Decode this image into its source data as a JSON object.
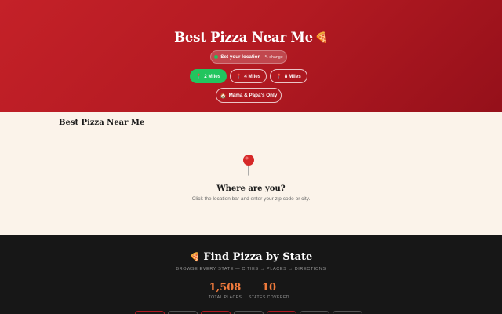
{
  "hero": {
    "title": "Best Pizza Near Me",
    "title_emoji": "🍕",
    "location": {
      "label": "Set your location",
      "change": "✎ change"
    },
    "radius_options": [
      {
        "label": "2 Miles",
        "icon": "📍",
        "active": true
      },
      {
        "label": "4 Miles",
        "icon": "📍",
        "active": false
      },
      {
        "label": "8 Miles",
        "icon": "📍",
        "active": false
      }
    ],
    "filter": {
      "label": "Mama & Papa's Only",
      "icon": "🏠"
    }
  },
  "main": {
    "heading": "Best Pizza Near Me",
    "empty_title": "Where are you?",
    "empty_subtitle": "Click the location bar and enter your zip code or city."
  },
  "states": {
    "title": "Find Pizza by State",
    "title_emoji": "🍕",
    "subtitle": "BROWSE EVERY STATE — CITIES → PLACES → DIRECTIONS",
    "stats": [
      {
        "value": "1,508",
        "label": "TOTAL PLACES"
      },
      {
        "value": "10",
        "label": "STATES COVERED"
      }
    ]
  },
  "colors": {
    "hero_red": "#c42128",
    "accent_green": "#22c55e",
    "stat_orange": "#f07a3c",
    "dark_bg": "#171717",
    "cream_bg": "#fbf3ea"
  },
  "icons": [
    "location-dot-icon",
    "pin-icon",
    "house-icon",
    "map-pin-icon",
    "pizza-icon"
  ]
}
